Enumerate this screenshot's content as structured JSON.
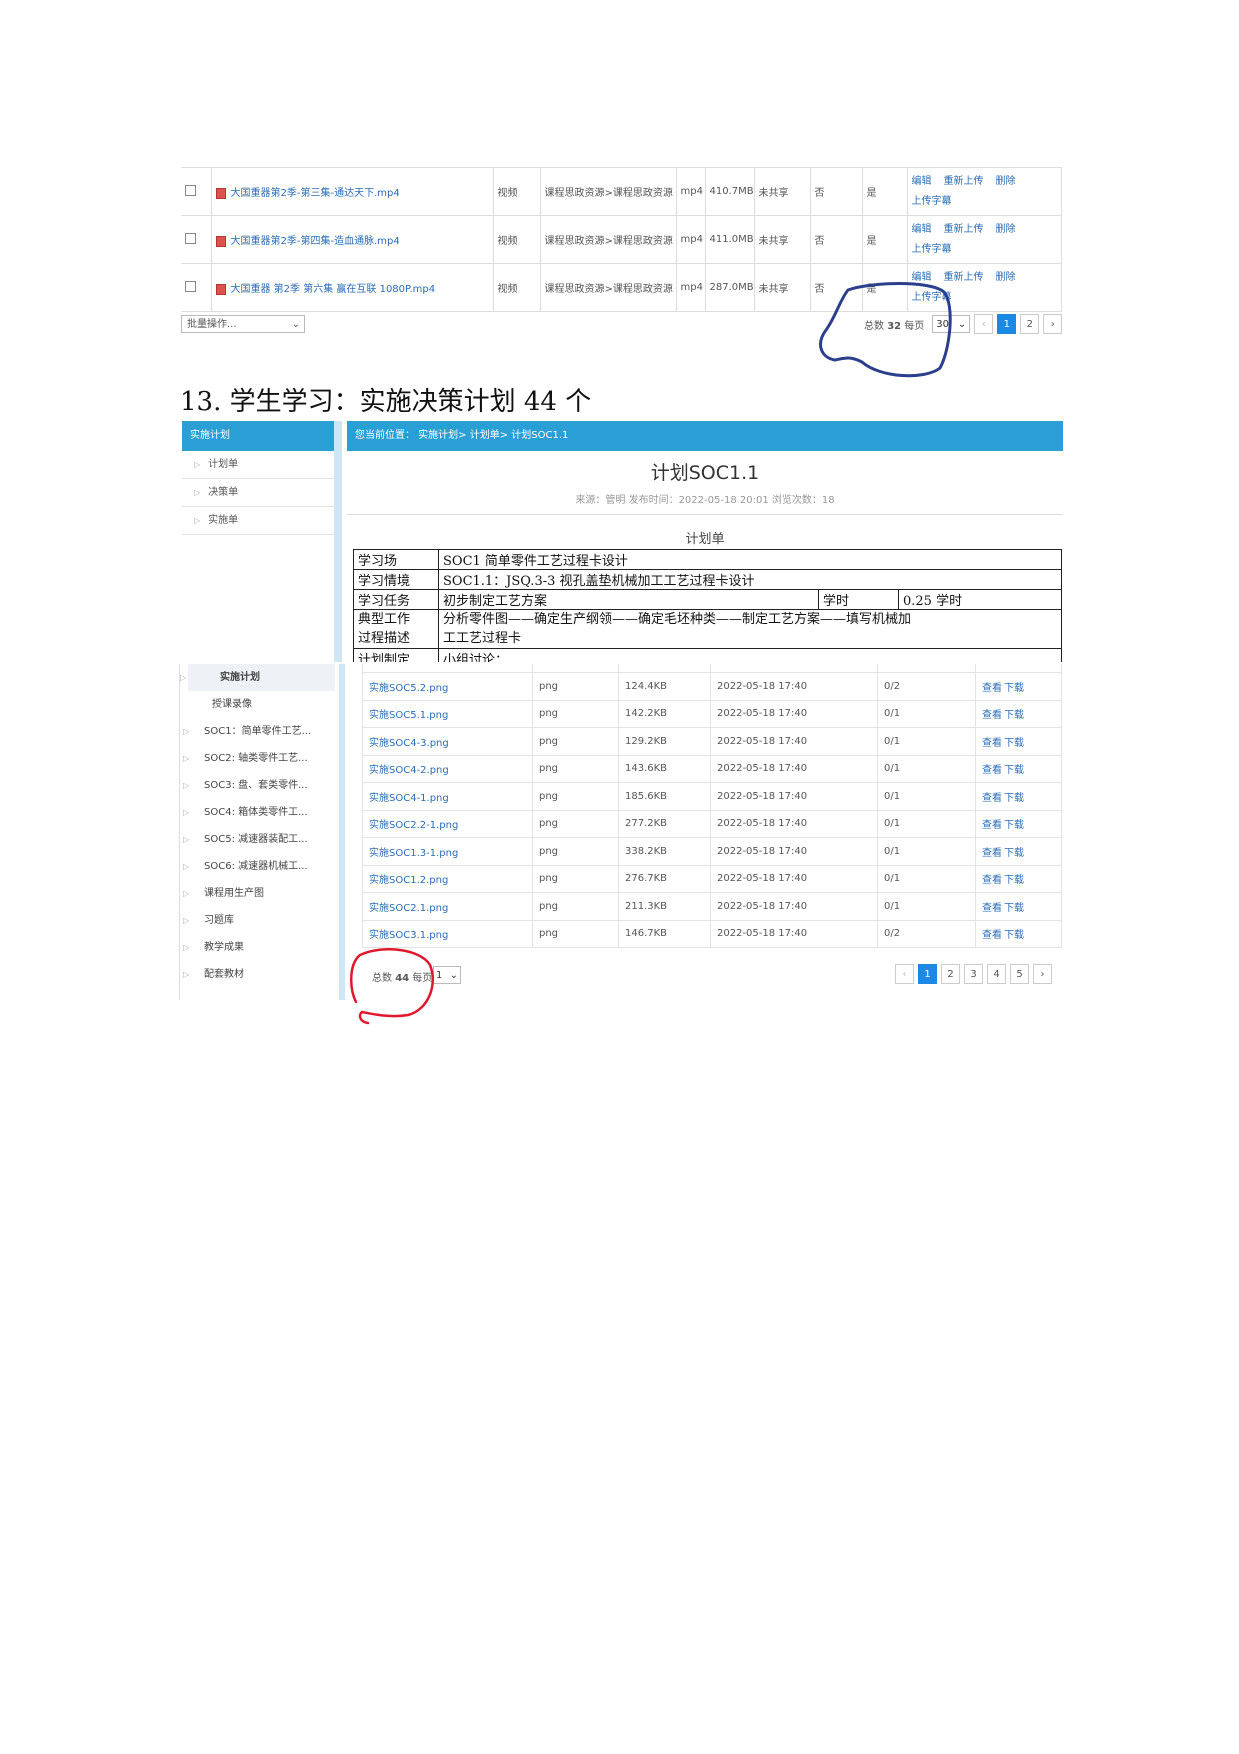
{
  "top_table": {
    "rows": [
      {
        "name": "大国重器第2季-第三集-通达天下.mp4",
        "type": "视频",
        "path": "课程思政资源>课程思政资源",
        "ext": "mp4",
        "size": "410.7MB",
        "share": "未共享",
        "col_a": "否",
        "col_b": "是"
      },
      {
        "name": "大国重器第2季-第四集-造血通脉.mp4",
        "type": "视频",
        "path": "课程思政资源>课程思政资源",
        "ext": "mp4",
        "size": "411.0MB",
        "share": "未共享",
        "col_a": "否",
        "col_b": "是"
      },
      {
        "name": "大国重器 第2季 第六集 赢在互联 1080P.mp4",
        "type": "视频",
        "path": "课程思政资源>课程思政资源",
        "ext": "mp4",
        "size": "287.0MB",
        "share": "未共享",
        "col_a": "否",
        "col_b": "是"
      }
    ],
    "ops": {
      "edit": "编辑",
      "reupload": "重新上传",
      "delete": "删除",
      "subtitle": "上传字幕"
    },
    "batch_label": "批量操作...",
    "total_prefix": "总数",
    "total": "32",
    "per_page_label": "每页",
    "per_page": "30",
    "pages": [
      "1",
      "2"
    ]
  },
  "heading": "13. 学生学习：实施决策计划 44 个",
  "plan_view": {
    "sidebar_title": "实施计划",
    "sidebar_items": [
      "计划单",
      "决策单",
      "实施单"
    ],
    "breadcrumb": "您当前位置： 实施计划> 计划单> 计划SOC1.1",
    "title": "计划SOC1.1",
    "meta": "来源：管明    发布时间：2022-05-18 20:01  浏览次数：18",
    "plan_heading": "计划单",
    "rows": {
      "r1_label": "学习场",
      "r1_value": "SOC1 简单零件工艺过程卡设计",
      "r2_label": "学习情境",
      "r2_value": "SOC1.1：JSQ.3-3 视孔盖垫机械加工工艺过程卡设计",
      "r3_label": "学习任务",
      "r3_value": "初步制定工艺方案",
      "r3_hours_label": "学时",
      "r3_hours": "0.25 学时",
      "r4_label_1": "典型工作",
      "r4_label_2": "过程描述",
      "r4_value_1": "分析零件图——确定生产纲领——确定毛坯种类——制定工艺方案——填写机械加",
      "r4_value_2": "工工艺过程卡",
      "r5_label": "计划制定",
      "r5_value": "小组讨论："
    }
  },
  "file_list": {
    "sidebar_items": [
      "实施计划",
      "授课录像",
      "SOC1：简单零件工艺...",
      "SOC2: 轴类零件工艺...",
      "SOC3: 盘、套类零件...",
      "SOC4: 箱体类零件工...",
      "SOC5: 减速器装配工...",
      "SOC6: 减速器机械工...",
      "课程用生产图",
      "习题库",
      "教学成果",
      "配套教材"
    ],
    "rows": [
      {
        "name": "实施SOC5.2.png",
        "ext": "png",
        "size": "124.4KB",
        "time": "2022-05-18 17:40",
        "count": "0/2"
      },
      {
        "name": "实施SOC5.1.png",
        "ext": "png",
        "size": "142.2KB",
        "time": "2022-05-18 17:40",
        "count": "0/1"
      },
      {
        "name": "实施SOC4-3.png",
        "ext": "png",
        "size": "129.2KB",
        "time": "2022-05-18 17:40",
        "count": "0/1"
      },
      {
        "name": "实施SOC4-2.png",
        "ext": "png",
        "size": "143.6KB",
        "time": "2022-05-18 17:40",
        "count": "0/1"
      },
      {
        "name": "实施SOC4-1.png",
        "ext": "png",
        "size": "185.6KB",
        "time": "2022-05-18 17:40",
        "count": "0/1"
      },
      {
        "name": "实施SOC2.2-1.png",
        "ext": "png",
        "size": "277.2KB",
        "time": "2022-05-18 17:40",
        "count": "0/1"
      },
      {
        "name": "实施SOC1.3-1.png",
        "ext": "png",
        "size": "338.2KB",
        "time": "2022-05-18 17:40",
        "count": "0/1"
      },
      {
        "name": "实施SOC1.2.png",
        "ext": "png",
        "size": "276.7KB",
        "time": "2022-05-18 17:40",
        "count": "0/1"
      },
      {
        "name": "实施SOC2.1.png",
        "ext": "png",
        "size": "211.3KB",
        "time": "2022-05-18 17:40",
        "count": "0/1"
      },
      {
        "name": "实施SOC3.1.png",
        "ext": "png",
        "size": "146.7KB",
        "time": "2022-05-18 17:40",
        "count": "0/2"
      }
    ],
    "view_label": "查看",
    "download_label": "下载",
    "total_prefix": "总数",
    "total": "44",
    "per_page_label": "每页",
    "per_page": "1",
    "pages": [
      "1",
      "2",
      "3",
      "4",
      "5"
    ]
  },
  "annotation_color": "#2b3f8c",
  "annotation_color_2": "#e0182d",
  "icons": [
    "file-icon",
    "checkbox-icon",
    "chevron-down-icon",
    "chevron-left-icon",
    "chevron-right-icon",
    "triangle-right-icon"
  ]
}
